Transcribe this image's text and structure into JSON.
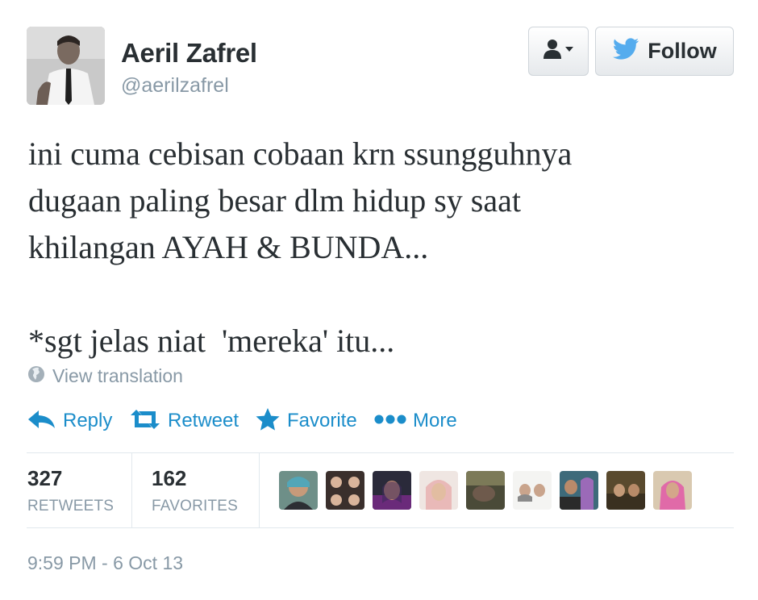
{
  "user": {
    "name": "Aeril Zafrel",
    "handle": "@aerilzafrel"
  },
  "header_buttons": {
    "user_menu_icon": "user-dropdown-icon",
    "follow_label": "Follow",
    "follow_icon": "bird-icon"
  },
  "tweet": {
    "text": "ini cuma cebisan cobaan krn ssungguhnya\ndugaan paling besar dlm hidup sy saat\nkhilangan AYAH & BUNDA...\n\n*sgt jelas niat  'mereka' itu...",
    "translate_label": "View translation"
  },
  "actions": [
    {
      "label": "Reply",
      "icon": "reply-icon"
    },
    {
      "label": "Retweet",
      "icon": "retweet-icon"
    },
    {
      "label": "Favorite",
      "icon": "star-icon"
    },
    {
      "label": "More",
      "icon": "more-dots-icon"
    }
  ],
  "stats": {
    "retweets": {
      "count": "327",
      "label": "RETWEETS"
    },
    "favorites": {
      "count": "162",
      "label": "FAVORITES"
    }
  },
  "timestamp": "9:59 PM - 6 Oct 13",
  "colors": {
    "link": "#1b8dca",
    "muted": "#8899a6",
    "text": "#292f33",
    "bird": "#55acee"
  }
}
